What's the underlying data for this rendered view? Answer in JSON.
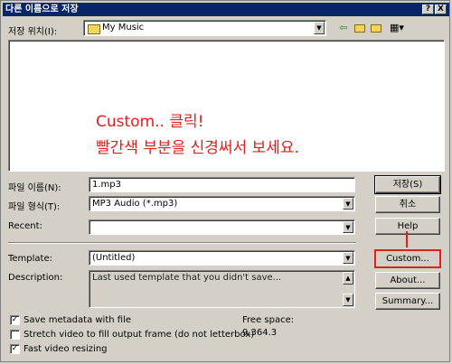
{
  "window": {
    "title": "다른 이름으로 저장",
    "help_glyph": "?",
    "close_glyph": "X"
  },
  "save_location": {
    "label": "저장 위치(I):",
    "value": "My Music"
  },
  "annotation": {
    "line1": "Custom.. 클릭!",
    "line2": "빨간색 부분을 신경써서 보세요.",
    "color": "#e02020"
  },
  "filename": {
    "label": "파일 이름(N):",
    "value": "1.mp3"
  },
  "filetype": {
    "label": "파일 형식(T):",
    "value": "MP3 Audio (*.mp3)"
  },
  "recent": {
    "label": "Recent:",
    "value": ""
  },
  "template": {
    "label": "Template:",
    "value": "(Untitled)"
  },
  "description": {
    "label": "Description:",
    "value": "Last used template that you didn't save..."
  },
  "buttons": {
    "save": "저장(S)",
    "cancel": "취소",
    "help": "Help",
    "custom": "Custom...",
    "about": "About...",
    "summary": "Summary..."
  },
  "options": [
    {
      "label": "Save metadata with file",
      "checked": true
    },
    {
      "label": "Stretch video to fill output frame (do not letterbox)",
      "checked": false
    },
    {
      "label": "Fast video resizing",
      "checked": true
    }
  ],
  "free_space": {
    "label": "Free space:",
    "value": "9,364.3"
  },
  "highlight_color": "#e02020",
  "titlebar_color": "#0a246a"
}
